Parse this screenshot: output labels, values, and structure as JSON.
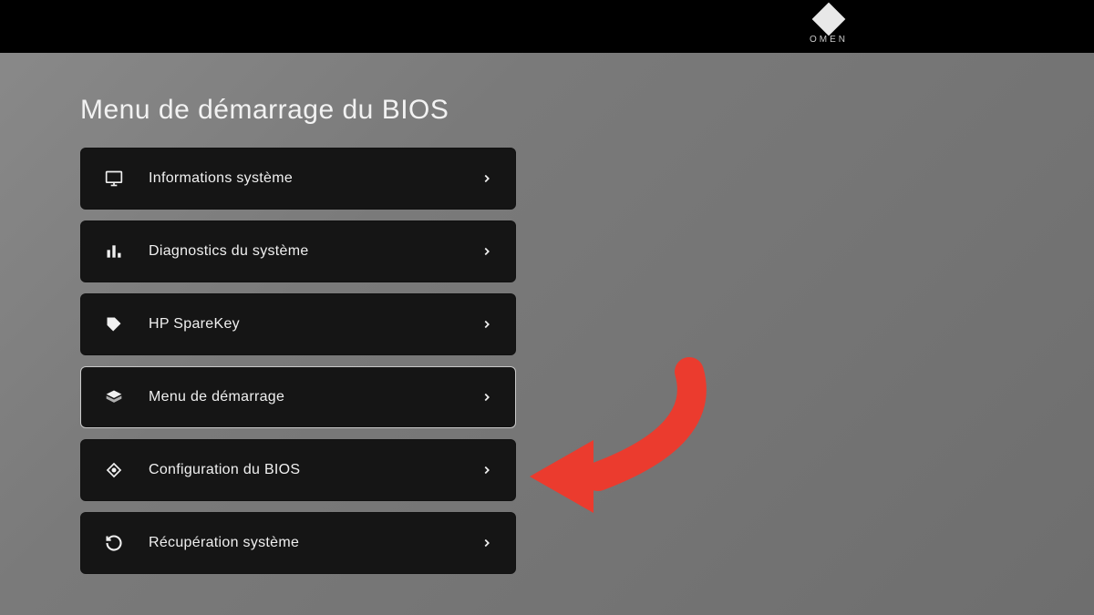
{
  "brand": {
    "label": "OMEN"
  },
  "page": {
    "title": "Menu de démarrage du BIOS"
  },
  "menu": {
    "items": [
      {
        "icon": "monitor-icon",
        "label": "Informations système",
        "selected": false
      },
      {
        "icon": "chart-icon",
        "label": "Diagnostics du système",
        "selected": false
      },
      {
        "icon": "tag-icon",
        "label": "HP SpareKey",
        "selected": false
      },
      {
        "icon": "layers-icon",
        "label": "Menu de démarrage",
        "selected": true
      },
      {
        "icon": "diamond-icon",
        "label": "Configuration du BIOS",
        "selected": false
      },
      {
        "icon": "refresh-icon",
        "label": "Récupération système",
        "selected": false
      }
    ]
  },
  "annotation": {
    "points_to_item_index": 4,
    "color": "#eb3b2e"
  }
}
